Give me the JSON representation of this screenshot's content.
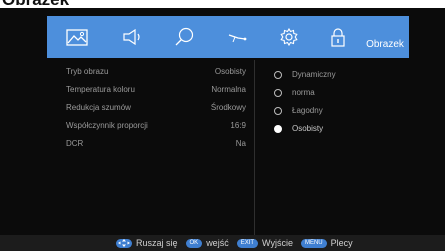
{
  "page": {
    "title": "Obrazek"
  },
  "tabs": [
    {
      "icon": "picture-icon"
    },
    {
      "icon": "speaker-icon"
    },
    {
      "icon": "search-icon"
    },
    {
      "icon": "satellite-icon"
    },
    {
      "icon": "gear-icon"
    },
    {
      "icon": "lock-icon"
    }
  ],
  "active_tab": {
    "label": "Obrazek"
  },
  "settings": [
    {
      "label": "Tryb obrazu",
      "value": "Osobisty"
    },
    {
      "label": "Temperatura koloru",
      "value": "Normalna"
    },
    {
      "label": "Redukcja szumów",
      "value": "Środkowy"
    },
    {
      "label": "Współczynnik proporcji",
      "value": "16:9"
    },
    {
      "label": "DCR",
      "value": "Na"
    }
  ],
  "options": [
    {
      "label": "Dynamiczny",
      "selected": false
    },
    {
      "label": "norma",
      "selected": false
    },
    {
      "label": "Łagodny",
      "selected": false
    },
    {
      "label": "Osobisty",
      "selected": true
    }
  ],
  "footer": {
    "move_label": "Ruszaj się",
    "ok_key": "OK",
    "ok_label": "wejść",
    "exit_key": "EXIT",
    "exit_label": "Wyjście",
    "menu_key": "MENU",
    "menu_label": "Plecy"
  },
  "colors": {
    "accent": "#4d8fdc",
    "background": "#0b0b0b",
    "text": "#9a9a9a"
  }
}
